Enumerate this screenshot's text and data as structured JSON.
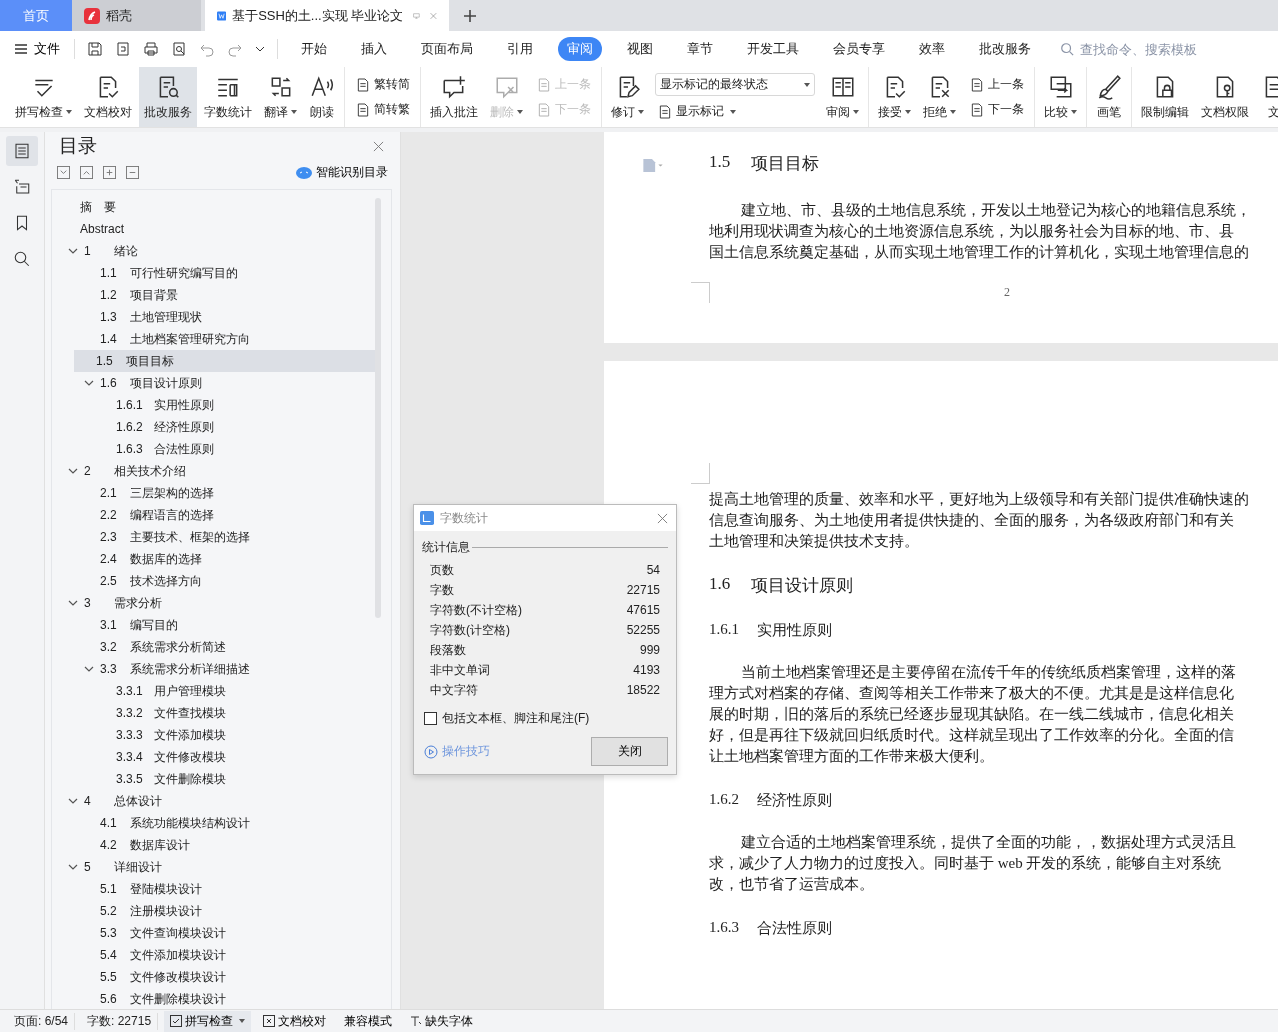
{
  "tab_bar": {
    "tabs": [
      {
        "kind": "home",
        "label": "首页",
        "selected": false
      },
      {
        "kind": "docer",
        "label": "稻壳",
        "selected": false
      },
      {
        "kind": "document",
        "label": "基于SSH的土...实现 毕业论文",
        "selected": true
      }
    ]
  },
  "menu_bar": {
    "file": "文件",
    "tabs": [
      {
        "label": "开始",
        "selected": false
      },
      {
        "label": "插入",
        "selected": false
      },
      {
        "label": "页面布局",
        "selected": false
      },
      {
        "label": "引用",
        "selected": false
      },
      {
        "label": "审阅",
        "selected": true
      },
      {
        "label": "视图",
        "selected": false
      },
      {
        "label": "章节",
        "selected": false
      },
      {
        "label": "开发工具",
        "selected": false
      },
      {
        "label": "会员专享",
        "selected": false
      },
      {
        "label": "效率",
        "selected": false
      },
      {
        "label": "批改服务",
        "selected": false
      }
    ],
    "search": {
      "placeholder": "查找命令、搜索模板"
    }
  },
  "ribbon": {
    "groups": [
      [
        {
          "kind": "large",
          "label": "拼写检查",
          "menu": true,
          "pressed": false,
          "disabled": false
        },
        {
          "kind": "large",
          "label": "文档校对",
          "menu": false,
          "pressed": false,
          "disabled": false
        },
        {
          "kind": "large",
          "label": "批改服务",
          "menu": false,
          "pressed": true,
          "disabled": false
        },
        {
          "kind": "large",
          "label": "字数统计",
          "menu": false,
          "pressed": false,
          "disabled": false
        },
        {
          "kind": "large",
          "label": "翻译",
          "menu": true,
          "pressed": false,
          "disabled": false
        },
        {
          "kind": "large",
          "label": "朗读",
          "menu": false,
          "pressed": false,
          "disabled": false
        }
      ],
      [
        {
          "kind": "stack",
          "items": [
            {
              "label": "繁转简",
              "disabled": false
            },
            {
              "label": "简转繁",
              "disabled": false
            }
          ]
        }
      ],
      [
        {
          "kind": "large",
          "label": "插入批注",
          "menu": false,
          "pressed": false,
          "disabled": false
        },
        {
          "kind": "large",
          "label": "删除",
          "menu": true,
          "pressed": false,
          "disabled": true
        },
        {
          "kind": "stack",
          "items": [
            {
              "label": "上一条",
              "disabled": true
            },
            {
              "label": "下一条",
              "disabled": true
            }
          ]
        }
      ],
      [
        {
          "kind": "large",
          "label": "修订",
          "menu": true,
          "pressed": false,
          "disabled": false
        },
        {
          "kind": "dropdown",
          "value": "显示标记的最终状态",
          "below": "显示标记"
        },
        {
          "kind": "large",
          "label": "审阅",
          "menu": true,
          "pressed": false,
          "disabled": false
        }
      ],
      [
        {
          "kind": "large",
          "label": "接受",
          "menu": true,
          "pressed": false,
          "disabled": false
        },
        {
          "kind": "large",
          "label": "拒绝",
          "menu": true,
          "pressed": false,
          "disabled": false
        },
        {
          "kind": "stack",
          "items": [
            {
              "label": "上一条",
              "disabled": false
            },
            {
              "label": "下一条",
              "disabled": false
            }
          ]
        }
      ],
      [
        {
          "kind": "large",
          "label": "比较",
          "menu": true,
          "pressed": false,
          "disabled": false
        }
      ],
      [
        {
          "kind": "large",
          "label": "画笔",
          "menu": false,
          "pressed": false,
          "disabled": false
        }
      ],
      [
        {
          "kind": "large",
          "label": "限制编辑",
          "menu": false,
          "pressed": false,
          "disabled": false
        },
        {
          "kind": "large",
          "label": "文档权限",
          "menu": false,
          "pressed": false,
          "disabled": false
        },
        {
          "kind": "large",
          "label": "文",
          "menu": false,
          "pressed": false,
          "disabled": false
        }
      ]
    ]
  },
  "left_rail": [
    {
      "selected": true
    },
    {
      "selected": false
    },
    {
      "selected": false
    },
    {
      "selected": false
    }
  ],
  "toc_panel": {
    "title": "目录",
    "smart_button": "智能识别目录",
    "items": [
      {
        "title": "摘　要",
        "selected": false
      },
      {
        "title": "Abstract",
        "selected": false
      },
      {
        "num": "1",
        "title": "绪论",
        "selected": false,
        "expanded": true,
        "children": [
          {
            "num": "1.1",
            "title": "可行性研究编写目的",
            "selected": false
          },
          {
            "num": "1.2",
            "title": "项目背景",
            "selected": false
          },
          {
            "num": "1.3",
            "title": "土地管理现状",
            "selected": false
          },
          {
            "num": "1.4",
            "title": "土地档案管理研究方向",
            "selected": false
          },
          {
            "num": "1.5",
            "title": "项目目标",
            "selected": true
          },
          {
            "num": "1.6",
            "title": "项目设计原则",
            "selected": false,
            "expanded": true,
            "children": [
              {
                "num": "1.6.1",
                "title": "实用性原则",
                "selected": false
              },
              {
                "num": "1.6.2",
                "title": "经济性原则",
                "selected": false
              },
              {
                "num": "1.6.3",
                "title": "合法性原则",
                "selected": false
              }
            ]
          }
        ]
      },
      {
        "num": "2",
        "title": "相关技术介绍",
        "selected": false,
        "expanded": true,
        "children": [
          {
            "num": "2.1",
            "title": "三层架构的选择",
            "selected": false
          },
          {
            "num": "2.2",
            "title": "编程语言的选择",
            "selected": false
          },
          {
            "num": "2.3",
            "title": "主要技术、框架的选择",
            "selected": false
          },
          {
            "num": "2.4",
            "title": "数据库的选择",
            "selected": false
          },
          {
            "num": "2.5",
            "title": "技术选择方向",
            "selected": false
          }
        ]
      },
      {
        "num": "3",
        "title": "需求分析",
        "selected": false,
        "expanded": true,
        "children": [
          {
            "num": "3.1",
            "title": "编写目的",
            "selected": false
          },
          {
            "num": "3.2",
            "title": "系统需求分析简述",
            "selected": false
          },
          {
            "num": "3.3",
            "title": "系统需求分析详细描述",
            "selected": false,
            "expanded": true,
            "children": [
              {
                "num": "3.3.1",
                "title": "用户管理模块",
                "selected": false
              },
              {
                "num": "3.3.2",
                "title": "文件查找模块",
                "selected": false
              },
              {
                "num": "3.3.3",
                "title": "文件添加模块",
                "selected": false
              },
              {
                "num": "3.3.4",
                "title": "文件修改模块",
                "selected": false
              },
              {
                "num": "3.3.5",
                "title": "文件删除模块",
                "selected": false
              }
            ]
          }
        ]
      },
      {
        "num": "4",
        "title": "总体设计",
        "selected": false,
        "expanded": true,
        "children": [
          {
            "num": "4.1",
            "title": "系统功能模块结构设计",
            "selected": false
          },
          {
            "num": "4.2",
            "title": "数据库设计",
            "selected": false
          }
        ]
      },
      {
        "num": "5",
        "title": "详细设计",
        "selected": false,
        "expanded": true,
        "children": [
          {
            "num": "5.1",
            "title": "登陆模块设计",
            "selected": false
          },
          {
            "num": "5.2",
            "title": "注册模块设计",
            "selected": false
          },
          {
            "num": "5.3",
            "title": "文件查询模块设计",
            "selected": false
          },
          {
            "num": "5.4",
            "title": "文件添加模块设计",
            "selected": false
          },
          {
            "num": "5.5",
            "title": "文件修改模块设计",
            "selected": false
          },
          {
            "num": "5.6",
            "title": "文件删除模块设计",
            "selected": false
          }
        ]
      }
    ]
  },
  "document": {
    "pages": [
      {
        "blocks": [
          {
            "kind": "h2",
            "num": "1.5",
            "title": "项目目标"
          },
          {
            "kind": "para",
            "indent": true,
            "lines": [
              "建立地、市、县级的土地信息系统，开发以土地登记为核心的地籍信息系统，",
              "地利用现状调查为核心的土地资源信息系统，为以服务社会为目标的地、市、县",
              "国土信息系统奠定基础，从而实现土地管理工作的计算机化，实现土地管理信息的"
            ]
          }
        ],
        "page_number": "2"
      },
      {
        "blocks": [
          {
            "kind": "para",
            "indent": false,
            "lines": [
              "提高土地管理的质量、效率和水平，更好地为上级领导和有关部门提供准确快速的",
              "信息查询服务、为土地使用者提供快捷的、全面的服务，为各级政府部门和有关",
              "土地管理和决策提供技术支持。"
            ]
          },
          {
            "kind": "h2",
            "num": "1.6",
            "title": "项目设计原则"
          },
          {
            "kind": "h3",
            "num": "1.6.1",
            "title": "实用性原则"
          },
          {
            "kind": "para",
            "indent": true,
            "lines": [
              "当前土地档案管理还是主要停留在流传千年的传统纸质档案管理，这样的落",
              "理方式对档案的存储、查阅等相关工作带来了极大的不便。尤其是是这样信息化",
              "展的时期，旧的落后的系统已经逐步显现其缺陷。在一线二线城市，信息化相关",
              "好，但是再往下级就回归纸质时代。这样就呈现出了工作效率的分化。全面的信",
              "让土地档案管理方面的工作带来极大便利。"
            ]
          },
          {
            "kind": "h3",
            "num": "1.6.2",
            "title": "经济性原则"
          },
          {
            "kind": "para",
            "indent": true,
            "lines": [
              "建立合适的土地档案管理系统，提供了全面的功能，，数据处理方式灵活且",
              "求，减少了人力物力的过度投入。同时基于 web 开发的系统，能够自主对系统",
              "改，也节省了运营成本。"
            ]
          },
          {
            "kind": "h3",
            "num": "1.6.3",
            "title": "合法性原则"
          }
        ]
      }
    ]
  },
  "word_count_dialog": {
    "title": "字数统计",
    "section": "统计信息",
    "rows": [
      {
        "label": "页数",
        "value": "54"
      },
      {
        "label": "字数",
        "value": "22715"
      },
      {
        "label": "字符数(不计空格)",
        "value": "47615"
      },
      {
        "label": "字符数(计空格)",
        "value": "52255"
      },
      {
        "label": "段落数",
        "value": "999"
      },
      {
        "label": "非中文单词",
        "value": "4193"
      },
      {
        "label": "中文字符",
        "value": "18522"
      }
    ],
    "include_checkbox": {
      "label": "包括文本框、脚注和尾注(F)",
      "checked": false
    },
    "tips_link": "操作技巧",
    "close_button": "关闭"
  },
  "status_bar": {
    "page": "页面: 6/54",
    "words": "字数: 22715",
    "items": [
      {
        "kind": "check",
        "label": "拼写检查",
        "menu": true
      },
      {
        "kind": "proof",
        "label": "文档校对",
        "menu": false
      },
      {
        "kind": "plain",
        "label": "兼容模式",
        "menu": false
      },
      {
        "kind": "font",
        "label": "缺失字体",
        "menu": false
      }
    ]
  }
}
